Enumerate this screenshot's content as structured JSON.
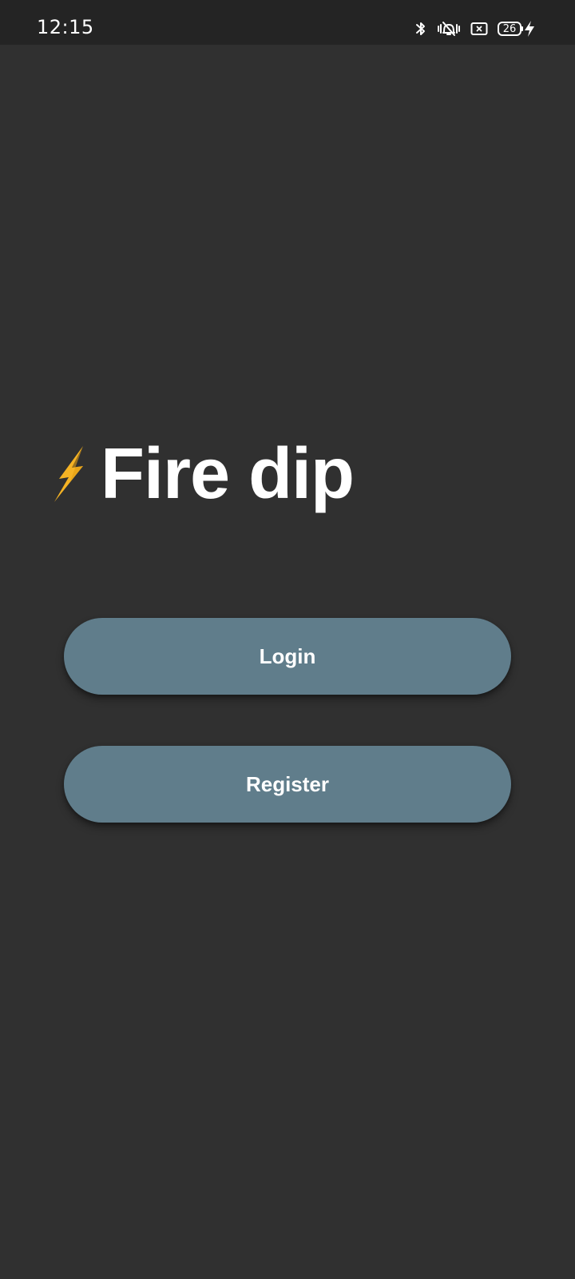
{
  "status_bar": {
    "time": "12:15",
    "battery_level": "26",
    "icons": [
      "bluetooth-icon",
      "vibrate-mute-icon",
      "no-sim-icon",
      "battery-icon",
      "charging-icon"
    ]
  },
  "app": {
    "title": "Fire dip",
    "logo_icon": "lightning-bolt-icon"
  },
  "actions": {
    "login_label": "Login",
    "register_label": "Register"
  },
  "colors": {
    "background": "#303030",
    "status_bar": "#242424",
    "button": "#607d8b",
    "bolt": "#f5b324",
    "text": "#ffffff"
  }
}
